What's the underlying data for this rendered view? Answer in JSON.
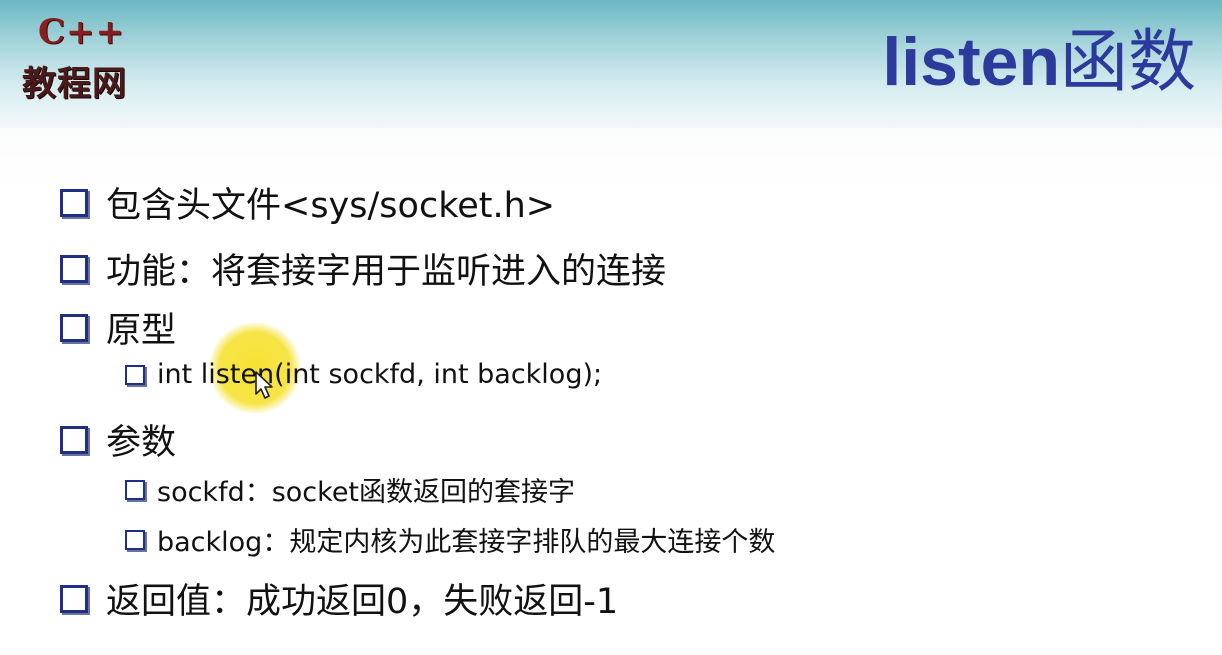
{
  "logo": {
    "line1": "C++",
    "line2": "教程网"
  },
  "title": {
    "en": "listen",
    "cn": "函数"
  },
  "bullets": [
    {
      "level": 1,
      "text": "包含头文件<sys/socket.h>"
    },
    {
      "level": 1,
      "text": "功能：将套接字用于监听进入的连接"
    },
    {
      "level": 1,
      "text": "原型"
    },
    {
      "level": 2,
      "text": "int listen(int sockfd, int backlog);"
    },
    {
      "level": 1,
      "text": "参数"
    },
    {
      "level": 2,
      "text": "sockfd：socket函数返回的套接字"
    },
    {
      "level": 2,
      "text": "backlog：规定内核为此套接字排队的最大连接个数"
    },
    {
      "level": 1,
      "text": "返回值：成功返回0，失败返回-1"
    }
  ],
  "colors": {
    "title": "#2b3a9b",
    "bullet_box": "#1f2f86",
    "logo_red": "#8a1d1d",
    "highlight": "#f5e028"
  },
  "icons": {
    "bullet": "square-outline-icon",
    "cursor": "mouse-pointer-icon"
  }
}
